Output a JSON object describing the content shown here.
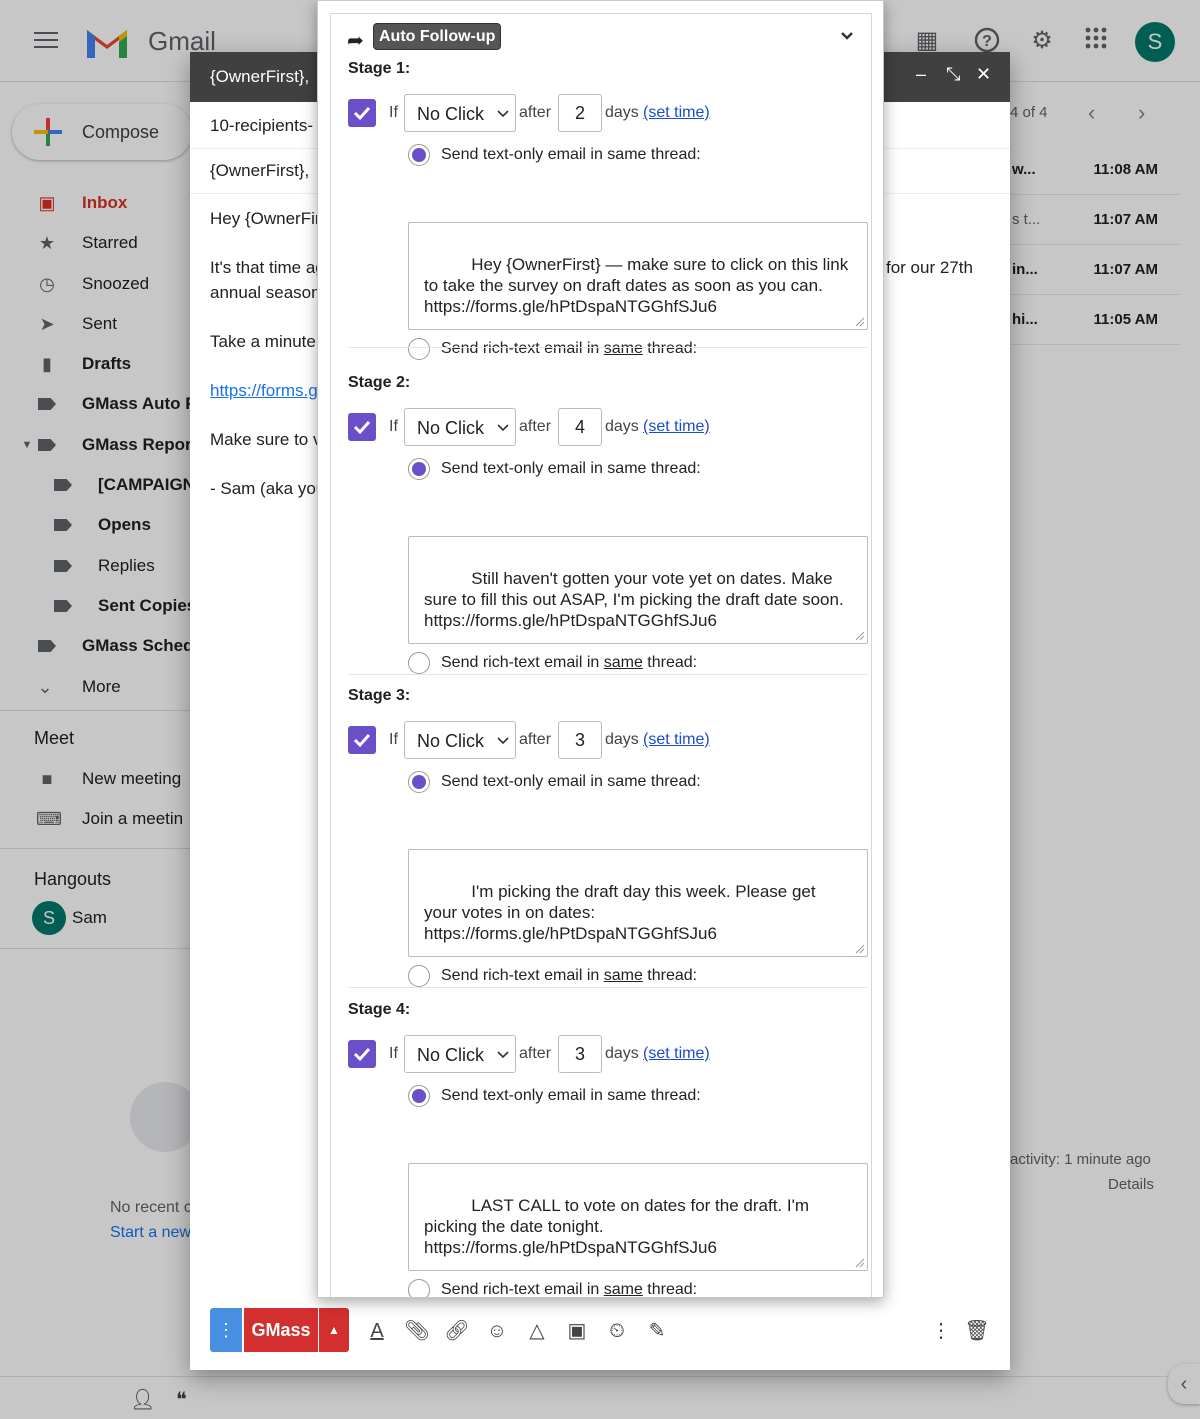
{
  "gmail": {
    "brand": "Gmail",
    "avatar_letter": "S",
    "compose_label": "Compose",
    "nav": [
      {
        "label": "Inbox",
        "icon": "inbox-icon"
      },
      {
        "label": "Starred",
        "icon": "star-icon"
      },
      {
        "label": "Snoozed",
        "icon": "clock-icon"
      },
      {
        "label": "Sent",
        "icon": "send-icon"
      },
      {
        "label": "Drafts",
        "icon": "draft-icon"
      },
      {
        "label": "GMass Auto F",
        "icon": "label-icon"
      },
      {
        "label": "GMass Repor",
        "icon": "label-icon"
      },
      {
        "label": "[CAMPAIGN",
        "icon": "label-icon"
      },
      {
        "label": "Opens",
        "icon": "label-icon"
      },
      {
        "label": "Replies",
        "icon": "label-icon"
      },
      {
        "label": "Sent Copies",
        "icon": "label-icon"
      },
      {
        "label": "GMass Sched",
        "icon": "label-icon"
      },
      {
        "label": "More",
        "icon": "chevron-down-icon"
      }
    ],
    "meet": {
      "heading": "Meet",
      "new_meeting": "New meeting",
      "join_meeting": "Join a meetin"
    },
    "hangouts": {
      "heading": "Hangouts",
      "user_letter": "S",
      "user_name": "Sam",
      "no_recent": "No recent c",
      "start_new": "Start a new"
    },
    "pager": "4 of 4",
    "rows": [
      {
        "snippet": "w...",
        "time": "11:08 AM"
      },
      {
        "snippet": "s t...",
        "time": "11:07 AM"
      },
      {
        "snippet": "in...",
        "time": "11:07 AM"
      },
      {
        "snippet": "hi...",
        "time": "11:05 AM"
      }
    ],
    "activity": "activity: 1 minute ago",
    "details": "Details"
  },
  "compose": {
    "title": "{OwnerFirst},",
    "to": "10-recipients-",
    "subject": "{OwnerFirst},",
    "body": [
      "Hey {OwnerFir",
      "It's that time ag",
      "annual season",
      "Take a minute",
      "https://forms.gl",
      "Make sure to v",
      "- Sam (aka you"
    ],
    "right_text": "for our 27th",
    "send_label": "GMass",
    "dots_label": "⋮"
  },
  "followup": {
    "title": "Auto Follow-up",
    "stages": [
      {
        "title": "Stage 1:",
        "if_label": "If",
        "condition": "No Click",
        "after_label": "after",
        "days": "2",
        "days_label": "days",
        "set_time": "(set time)",
        "text_only_label": "Send text-only email in same thread:",
        "message": "Hey {OwnerFirst} — make sure to click on this link to take the survey on draft dates as soon as you can. https://forms.gle/hPtDspaNTGGhfSJu6",
        "rich_pre": "Send rich-text email in ",
        "rich_same": "same",
        "rich_post": " thread:"
      },
      {
        "title": "Stage 2:",
        "if_label": "If",
        "condition": "No Click",
        "after_label": "after",
        "days": "4",
        "days_label": "days",
        "set_time": "(set time)",
        "text_only_label": "Send text-only email in same thread:",
        "message": "Still haven't gotten your vote yet on dates. Make sure to fill this out ASAP, I'm picking the draft date soon. https://forms.gle/hPtDspaNTGGhfSJu6",
        "rich_pre": "Send rich-text email in ",
        "rich_same": "same",
        "rich_post": " thread:"
      },
      {
        "title": "Stage 3:",
        "if_label": "If",
        "condition": "No Click",
        "after_label": "after",
        "days": "3",
        "days_label": "days",
        "set_time": "(set time)",
        "text_only_label": "Send text-only email in same thread:",
        "message": "I'm picking the draft day this week. Please get your votes in on dates:\nhttps://forms.gle/hPtDspaNTGGhfSJu6",
        "rich_pre": "Send rich-text email in ",
        "rich_same": "same",
        "rich_post": " thread:"
      },
      {
        "title": "Stage 4:",
        "if_label": "If",
        "condition": "No Click",
        "after_label": "after",
        "days": "3",
        "days_label": "days",
        "set_time": "(set time)",
        "text_only_label": "Send text-only email in same thread:",
        "message": "LAST CALL to vote on dates for the draft. I'm picking the date tonight.\nhttps://forms.gle/hPtDspaNTGGhfSJu6",
        "rich_pre": "Send rich-text email in ",
        "rich_same": "same",
        "rich_post": " thread:"
      }
    ]
  },
  "colors": {
    "accent_purple": "#6a4fc8",
    "gmass_red": "#d32f2f",
    "dots_blue": "#4a90e2",
    "inbox_red": "#d93025",
    "link_blue": "#1a4ccf"
  }
}
